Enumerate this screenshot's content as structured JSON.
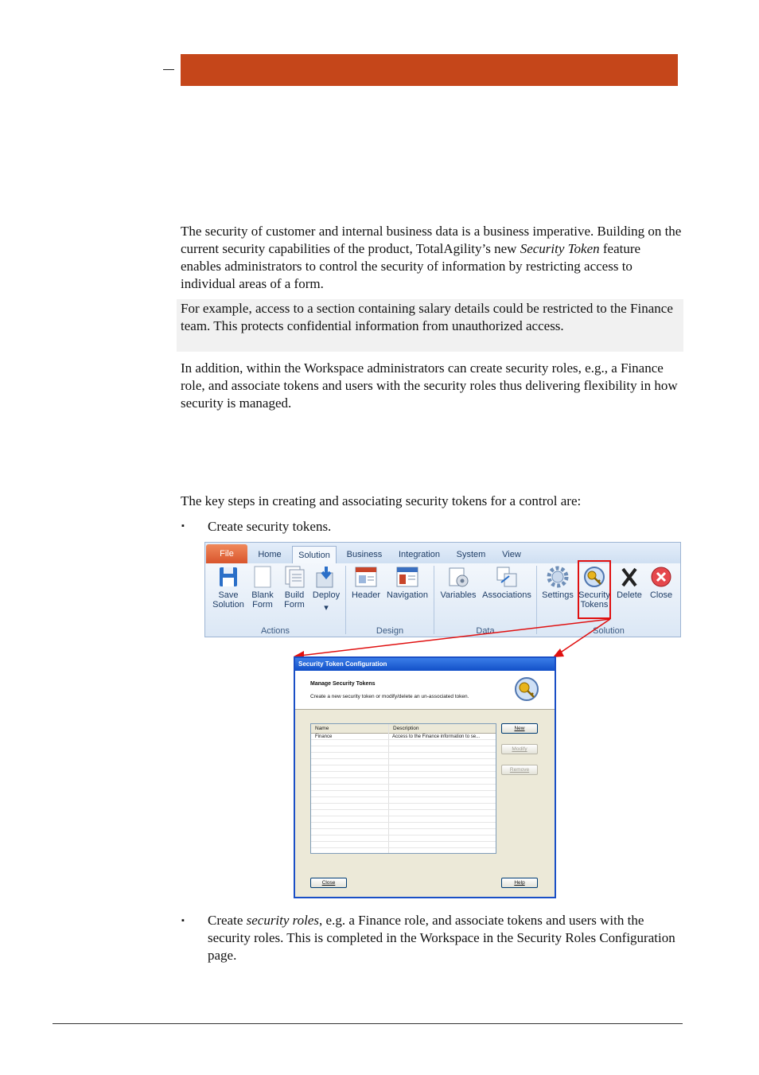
{
  "paragraphs": {
    "p1": "The security of customer and internal business data is a business imperative. Building on the current security capabilities of the product, TotalAgility’s new ",
    "p1_em": "Security Token",
    "p1_tail": " feature enables administrators to control the security of information by restricting access to individual areas of a form.",
    "p2": "For example, access to a section containing salary details could be restricted to the Finance team. This protects confidential information from unauthorized access.",
    "p3": "In addition, within the Workspace administrators can create security roles, e.g., a Finance role, and associate tokens and users with the security roles thus delivering flexibility in how security is managed.",
    "p4": "The key steps in creating and associating security tokens for a control are:"
  },
  "bullets": {
    "marker": "▪",
    "b1": "Create security tokens.",
    "b2_pre": "Create ",
    "b2_em": "security roles",
    "b2_tail": ", e.g. a Finance role, and associate tokens and users with the security roles. This is completed in the Workspace in the Security Roles Configuration page."
  },
  "ribbon": {
    "tabs": [
      "File",
      "Home",
      "Solution",
      "Business",
      "Integration",
      "System",
      "View"
    ],
    "active_tab": "Solution",
    "buttons": {
      "save": "Save\nSolution",
      "blank": "Blank\nForm",
      "build": "Build\nForm",
      "deploy": "Deploy",
      "deploy_arrow": "▾",
      "header": "Header",
      "navigation": "Navigation",
      "variables": "Variables",
      "associations": "Associations",
      "settings": "Settings",
      "tokens": "Security\nTokens",
      "delete": "Delete",
      "close": "Close"
    },
    "groups": {
      "actions": "Actions",
      "design": "Design",
      "data": "Data",
      "solution": "Solution"
    },
    "accent": "#e01010"
  },
  "dialog": {
    "title": "Security Token Configuration",
    "heading": "Manage Security Tokens",
    "subheading": "Create a new security token or modify/delete an un-associated token.",
    "columns": [
      "Name",
      "Description"
    ],
    "rows": [
      {
        "name": "Finance",
        "description": "Access to the Finance information to se..."
      }
    ],
    "buttons": {
      "new": "New",
      "modify": "Modify",
      "remove": "Remove",
      "close": "Close",
      "help": "Help"
    }
  }
}
